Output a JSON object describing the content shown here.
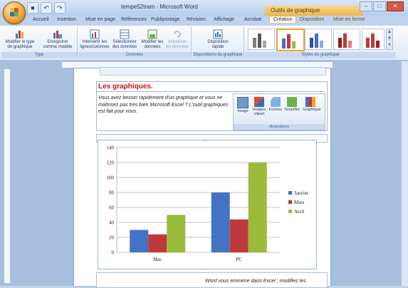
{
  "window": {
    "title": "tempe52tram - Microsoft Word",
    "context_tab": "Outils de graphique"
  },
  "tabs": [
    {
      "label": "Accueil"
    },
    {
      "label": "Insertion"
    },
    {
      "label": "Mise en page"
    },
    {
      "label": "Références"
    },
    {
      "label": "Publipostage"
    },
    {
      "label": "Révision"
    },
    {
      "label": "Affichage"
    },
    {
      "label": "Acrobat"
    },
    {
      "label": "Création"
    },
    {
      "label": "Disposition"
    },
    {
      "label": "Mise en forme"
    }
  ],
  "ribbon": {
    "type_group": {
      "label": "Type",
      "change_type": "Modifier le type de graphique",
      "save_model": "Enregistrer comme modèle"
    },
    "data_group": {
      "label": "Données",
      "switch": "Intervertir les lignes/colonnes",
      "select": "Sélectionner des données",
      "edit": "Modifier les données",
      "refresh": "Actualiser les données"
    },
    "layout_group": {
      "label": "Dispositions du graphique",
      "quick": "Disposition rapide"
    },
    "styles_group": {
      "label": "Styles du graphique"
    }
  },
  "document": {
    "heading": "Les graphiques.",
    "intro": "Vous avez besoin rapidement d'un graphique et vous ne maîtrisez pas très bien Microsoft Excel ? L'outil graphiques est fait pour vous.",
    "illustrations": {
      "label": "Illustrations",
      "buttons": [
        "Image",
        "Images clipart",
        "Formes",
        "SmartArt",
        "Graphique"
      ]
    },
    "bottom_text": "Word vous emmène dans Excel ; modifiez les"
  },
  "colors": {
    "janvier": "#4472c4",
    "mars": "#c0393a",
    "avril": "#9bbb3a",
    "heading": "#c0151c"
  },
  "chart_data": {
    "type": "bar",
    "categories": [
      "Mac",
      "PC"
    ],
    "series": [
      {
        "name": "Janvier",
        "values": [
          30,
          80
        ]
      },
      {
        "name": "Mars",
        "values": [
          24,
          44
        ]
      },
      {
        "name": "Avril",
        "values": [
          50,
          120
        ]
      }
    ],
    "yticks": [
      "0",
      "20",
      "40",
      "60",
      "80",
      "100",
      "120",
      "140"
    ],
    "ylim": [
      0,
      140
    ],
    "grid": true,
    "legend": "right"
  }
}
